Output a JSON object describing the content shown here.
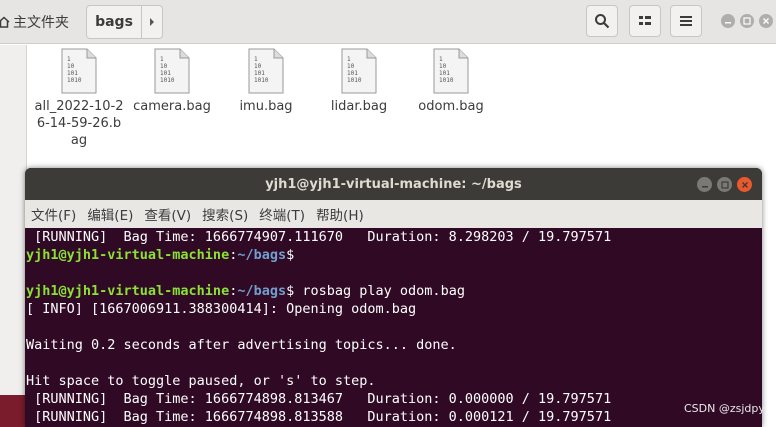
{
  "file_manager": {
    "home_label": "主文件夹",
    "current_folder": "bags",
    "files": [
      {
        "name": "all_2022-10-26-14-59-26.bag"
      },
      {
        "name": "camera.bag"
      },
      {
        "name": "imu.bag"
      },
      {
        "name": "lidar.bag"
      },
      {
        "name": "odom.bag"
      }
    ],
    "file_icon_text": [
      "1",
      "10",
      "101",
      "1010"
    ],
    "icons": {
      "home": "home-icon",
      "next": "chevron-right-icon",
      "search": "search-icon",
      "view": "view-options-icon",
      "menu": "hamburger-menu-icon",
      "minimize": "minimize-icon",
      "maximize": "maximize-icon",
      "close": "close-icon",
      "eject": "eject-icon"
    }
  },
  "terminal": {
    "title": "yjh1@yjh1-virtual-machine: ~/bags",
    "menu": [
      "文件(F)",
      "编辑(E)",
      "查看(V)",
      "搜索(S)",
      "终端(T)",
      "帮助(H)"
    ],
    "prompt_user": "yjh1@yjh1-virtual-machine",
    "prompt_path": "~/bags",
    "prompt_sep": ":",
    "prompt_end": "$",
    "command": " rosbag play odom.bag",
    "lines": {
      "l1": " [RUNNING]  Bag Time: 1666774907.111670   Duration: 8.298203 / 19.797571",
      "l5": "[ INFO] [1667006911.388300414]: Opening odom.bag",
      "l7": "Waiting 0.2 seconds after advertising topics... done.",
      "l9": "Hit space to toggle paused, or 's' to step.",
      "l10": " [RUNNING]  Bag Time: 1666774898.813467   Duration: 0.000000 / 19.797571",
      "l11": " [RUNNING]  Bag Time: 1666774898.813588   Duration: 0.000121 / 19.797571"
    }
  },
  "watermark": "CSDN @zsjdpy",
  "colors": {
    "terminal_bg": "#300a24",
    "prompt_user": "#8ae234",
    "prompt_path": "#729fcf",
    "close_button": "#e9592d"
  }
}
